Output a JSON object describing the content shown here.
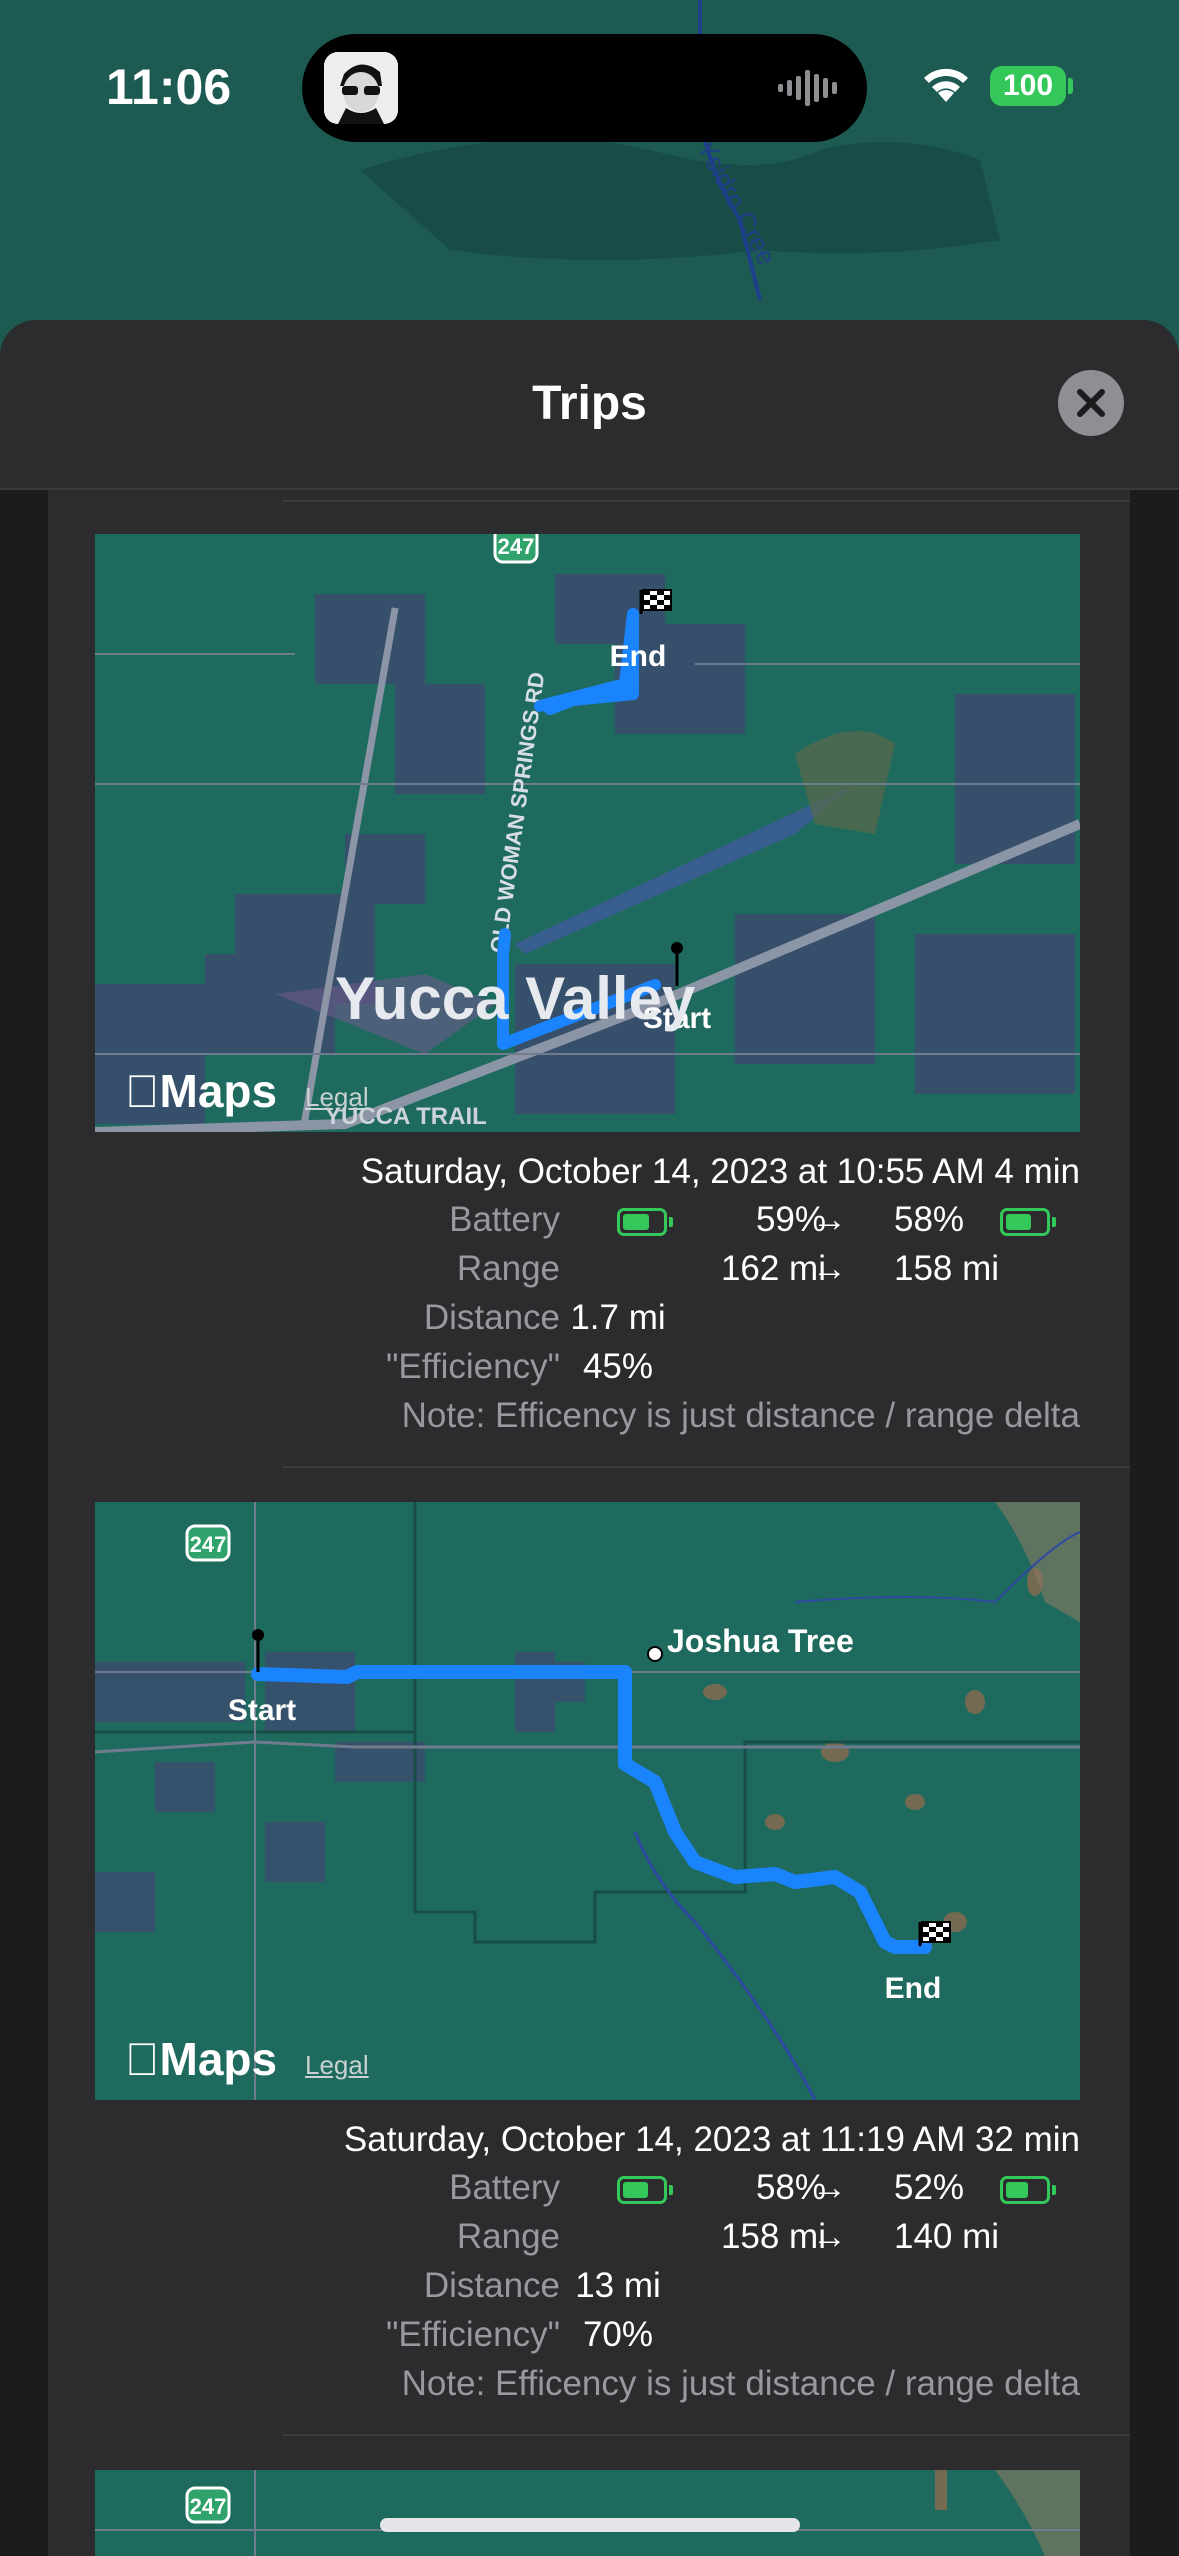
{
  "status_bar": {
    "time": "11:06",
    "battery": "100",
    "icons": [
      "avatar-icon",
      "audio-wave-icon",
      "wifi-icon",
      "battery-icon"
    ]
  },
  "background_map": {
    "label": "Ysidro Cree"
  },
  "sheet": {
    "title": "Trips",
    "close_icon": "close-icon"
  },
  "trips": [
    {
      "map": {
        "place": "Yucca Valley",
        "road": "OLD WOMAN SPRINGS RD",
        "trail": "YUCCA TRAIL",
        "highway": "247",
        "start": "Start",
        "end": "End",
        "logo": "Maps",
        "legal": "Legal"
      },
      "datetime": "Saturday, October 14, 2023 at 10:55 AM   4 min",
      "battery_label": "Battery",
      "battery_start": "59%",
      "battery_end": "58%",
      "range_label": "Range",
      "range_start": "162 mi",
      "range_end": "158 mi",
      "distance_label": "Distance",
      "distance": "1.7 mi",
      "efficiency_label": "\"Efficiency\"",
      "efficiency": "45%",
      "note": "Note: Efficency is just distance / range delta"
    },
    {
      "map": {
        "place": "Joshua Tree",
        "highway": "247",
        "start": "Start",
        "end": "End",
        "logo": "Maps",
        "legal": "Legal"
      },
      "datetime": "Saturday, October 14, 2023 at 11:19 AM   32 min",
      "battery_label": "Battery",
      "battery_start": "58%",
      "battery_end": "52%",
      "range_label": "Range",
      "range_start": "158 mi",
      "range_end": "140 mi",
      "distance_label": "Distance",
      "distance": "13 mi",
      "efficiency_label": "\"Efficiency\"",
      "efficiency": "70%",
      "note": "Note: Efficency is just distance / range delta"
    },
    {
      "map": {
        "highway": "247"
      }
    }
  ],
  "colors": {
    "accent_route": "#1a84ff",
    "battery_green": "#34c759",
    "sheet_bg": "#2c2c2e",
    "map_green": "#1f6a5f"
  }
}
